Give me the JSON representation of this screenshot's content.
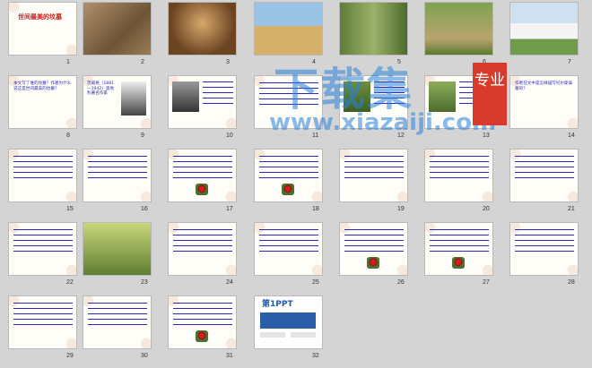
{
  "slides": [
    {
      "n": "1",
      "title": "世间最美的坟墓",
      "text": "",
      "kind": "title"
    },
    {
      "n": "2",
      "title": "",
      "text": "",
      "kind": "photo-terracotta"
    },
    {
      "n": "3",
      "title": "",
      "text": "",
      "kind": "photo-tomb"
    },
    {
      "n": "4",
      "title": "",
      "text": "",
      "kind": "photo-pyramid"
    },
    {
      "n": "5",
      "title": "",
      "text": "",
      "kind": "photo-forest"
    },
    {
      "n": "6",
      "title": "",
      "text": "",
      "kind": "photo-path"
    },
    {
      "n": "7",
      "title": "",
      "text": "",
      "kind": "photo-house"
    },
    {
      "n": "8",
      "title": "",
      "text": "本文写了谁的坟墓？作者为什么说这是世间最美的坟墓？",
      "kind": "text"
    },
    {
      "n": "9",
      "title": "",
      "text": "茨威格（1881—1942）奥地利著名作家",
      "kind": "photo-portrait"
    },
    {
      "n": "10",
      "title": "",
      "text": "",
      "kind": "photo-tolstoy"
    },
    {
      "n": "11",
      "title": "",
      "text": "",
      "kind": "text"
    },
    {
      "n": "12",
      "title": "",
      "text": "",
      "kind": "photo-grave"
    },
    {
      "n": "13",
      "title": "",
      "text": "",
      "kind": "photo-green"
    },
    {
      "n": "14",
      "title": "",
      "text": "作者在文中是怎样描写托尔斯泰墓的？",
      "kind": "text"
    },
    {
      "n": "15",
      "title": "",
      "text": "",
      "kind": "text"
    },
    {
      "n": "16",
      "title": "",
      "text": "",
      "kind": "text"
    },
    {
      "n": "17",
      "title": "",
      "text": "",
      "kind": "text-rose"
    },
    {
      "n": "18",
      "title": "",
      "text": "",
      "kind": "text-rose"
    },
    {
      "n": "19",
      "title": "",
      "text": "",
      "kind": "text"
    },
    {
      "n": "20",
      "title": "",
      "text": "",
      "kind": "text"
    },
    {
      "n": "21",
      "title": "",
      "text": "",
      "kind": "text"
    },
    {
      "n": "22",
      "title": "",
      "text": "",
      "kind": "text"
    },
    {
      "n": "23",
      "title": "",
      "text": "",
      "kind": "photo-forest2"
    },
    {
      "n": "24",
      "title": "",
      "text": "",
      "kind": "text"
    },
    {
      "n": "25",
      "title": "",
      "text": "",
      "kind": "text"
    },
    {
      "n": "26",
      "title": "",
      "text": "",
      "kind": "text-rose"
    },
    {
      "n": "27",
      "title": "",
      "text": "",
      "kind": "text-rose"
    },
    {
      "n": "28",
      "title": "",
      "text": "",
      "kind": "text"
    },
    {
      "n": "29",
      "title": "",
      "text": "",
      "kind": "text"
    },
    {
      "n": "30",
      "title": "",
      "text": "",
      "kind": "text"
    },
    {
      "n": "31",
      "title": "",
      "text": "",
      "kind": "text-rose"
    },
    {
      "n": "32",
      "title": "第1PPT",
      "text": "",
      "kind": "brand"
    }
  ],
  "watermark": {
    "big": "下载集",
    "url": "www.xiazaiji.com",
    "badge": "专业"
  },
  "colors": {
    "accent": "#d83a2c",
    "text_blue": "#2a2ab8",
    "text_red": "#c8201a"
  }
}
